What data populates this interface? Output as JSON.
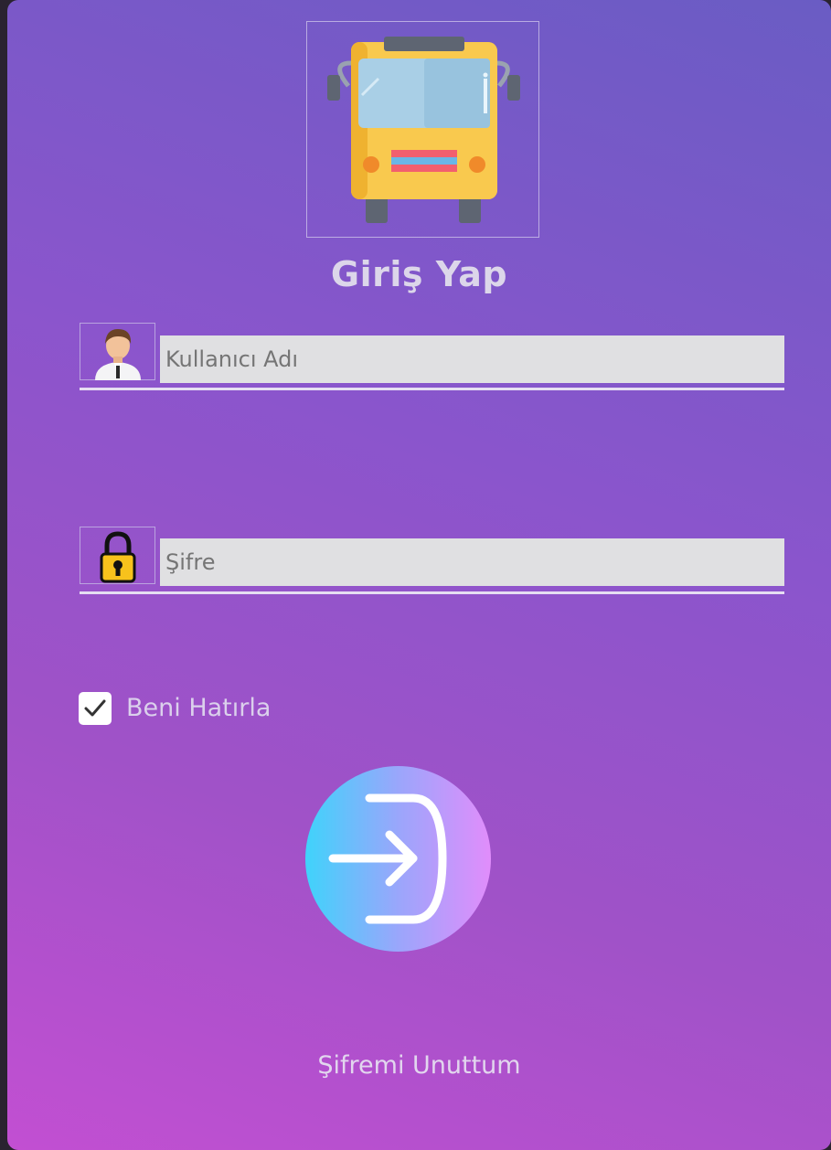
{
  "app": {
    "title": "Giriş Yap"
  },
  "logo": {
    "icon": "bus-icon"
  },
  "username": {
    "icon": "user-avatar-icon",
    "placeholder": "Kullanıcı Adı"
  },
  "password": {
    "icon": "padlock-icon",
    "placeholder": "Şifre"
  },
  "remember": {
    "label": "Beni Hatırla",
    "checked": true
  },
  "login_button": {
    "icon": "sign-in-arrow-icon"
  },
  "forgot_link": "Şifremi Unuttum",
  "colors": {
    "gradient_top": "#6a5cc4",
    "gradient_bottom": "#c24fd2",
    "button_start": "#3fd3fb",
    "button_end": "#e18dfb",
    "field_bg": "#e0e0e2"
  }
}
